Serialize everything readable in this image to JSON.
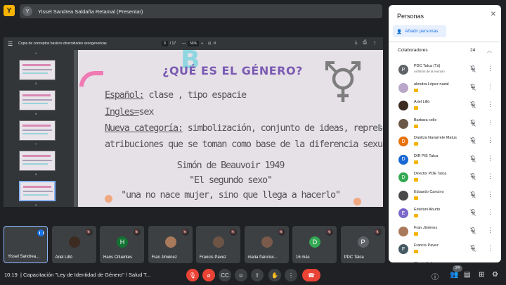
{
  "top": {
    "logo": "Y",
    "presenter_initial": "Y",
    "presenter_text": "Yissel Sandrea Saldaña Retamal (Presentar)"
  },
  "pdf": {
    "filename": "Copia de conceptos basicos diversidades sexogenericas",
    "page_current": "9",
    "page_total": "/ 17",
    "zoom": "56%",
    "thumb_numbers": [
      "4",
      "5",
      "6",
      "7",
      "8",
      "9"
    ]
  },
  "slide": {
    "title": "¿QUÉ ES EL GÉNERO?",
    "line1_label": "Español:",
    "line1_text": " clase , tipo espacie",
    "line2_label": "Ingles=",
    "line2_text": "sex",
    "line3_label": "Nueva categoría:",
    "line3_text": " simbolización, conjunto de ideas, representaciones y",
    "line4_text": "atribuciones que se toman como base de la diferencia sexual",
    "quote_author": "Simón de Beauvoir 1949",
    "quote_book": "\"El segundo sexo\"",
    "quote_text": "\"una no nace mujer, sino que llega a hacerlo\""
  },
  "panel": {
    "title": "Personas",
    "add_label": "Añadir personas",
    "collaborators_label": "Colaboradores",
    "collaborators_count": "24",
    "people": [
      {
        "name": "PDC Talca (Tú)",
        "sub": "Anfitrión de la reunión",
        "initial": "P",
        "color": "#5f6368"
      },
      {
        "name": "alondra López nazal",
        "sub": "",
        "initial": "",
        "color": "#b9a7c9"
      },
      {
        "name": "Ariel Lilló",
        "sub": "",
        "initial": "",
        "color": "#3d2b22"
      },
      {
        "name": "Barbara celis",
        "sub": "",
        "initial": "",
        "color": "#6b5846"
      },
      {
        "name": "Danitza Navarrete Matus",
        "sub": "",
        "initial": "D",
        "color": "#e8710a"
      },
      {
        "name": "DIR PIE Talca",
        "sub": "",
        "initial": "D",
        "color": "#1967d2"
      },
      {
        "name": "Director PDE Talca",
        "sub": "",
        "initial": "D",
        "color": "#34a853"
      },
      {
        "name": "Eduardo Cancino",
        "sub": "",
        "initial": "",
        "color": "#4a4a4a"
      },
      {
        "name": "Estefani Aburto",
        "sub": "",
        "initial": "E",
        "color": "#7b68c9"
      },
      {
        "name": "Fran Jiménez",
        "sub": "",
        "initial": "",
        "color": "#a8795a"
      },
      {
        "name": "Francis Pavez",
        "sub": "",
        "initial": "F",
        "color": "#455a64"
      },
      {
        "name": "Glosireth Lugo",
        "sub": "",
        "initial": "",
        "color": "#888888"
      }
    ]
  },
  "tiles": [
    {
      "name": "Yissel Sandrea...",
      "initial": "",
      "color": "#3c4043",
      "active": true
    },
    {
      "name": "Ariel Lilló",
      "initial": "",
      "color": "#3d2b22"
    },
    {
      "name": "Hans Cifuentes",
      "initial": "H",
      "color": "#137333"
    },
    {
      "name": "Fran Jiménez",
      "initial": "",
      "color": "#a8795a"
    },
    {
      "name": "Francis Pavez",
      "initial": "",
      "color": "#6d5546"
    },
    {
      "name": "maria francisc...",
      "initial": "",
      "color": "#7a5a4a"
    },
    {
      "name": "16 más",
      "initial": "D",
      "color": "#34a853"
    },
    {
      "name": "PDC Talca",
      "initial": "P",
      "color": "#5f6368"
    }
  ],
  "bottom": {
    "time": "10:19",
    "separator": "|",
    "meeting": "Capacitación \"Ley de Identidad de Género\" / Salud T...",
    "participants_badge": "24"
  }
}
